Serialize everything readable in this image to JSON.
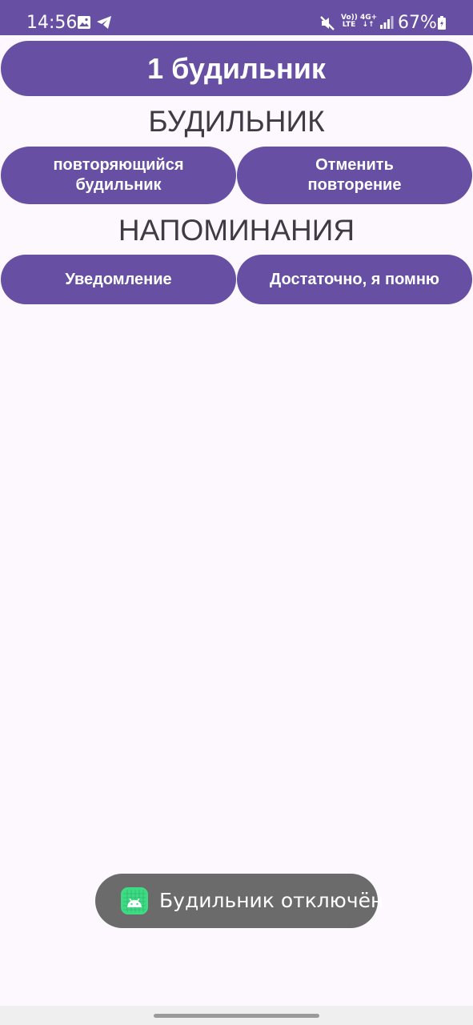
{
  "status_bar": {
    "time": "14:56",
    "volte_label_top": "Vo))",
    "volte_label_bottom": "LTE",
    "network_label": "4G+",
    "network_arrows": "↓↑",
    "battery_percent": "67%",
    "icons": [
      "gallery-icon",
      "telegram-icon",
      "mute-icon",
      "signal-icon",
      "battery-icon"
    ]
  },
  "header": {
    "title_button": "1 будильник"
  },
  "alarm_section": {
    "title": "БУДИЛЬНИК",
    "repeat_button": "повторяющийся будильник",
    "cancel_repeat_button": "Отменить повторение"
  },
  "reminders_section": {
    "title": "НАПОМИНАНИЯ",
    "notification_button": "Уведомление",
    "enough_button": "Достаточно, я помню"
  },
  "toast": {
    "icon": "android-app-icon",
    "message": "Будильник отключён"
  },
  "colors": {
    "accent": "#6750a4",
    "background": "#fdf8fd",
    "section_text": "#3f3b45",
    "toast_background": "#6b6b6b"
  }
}
